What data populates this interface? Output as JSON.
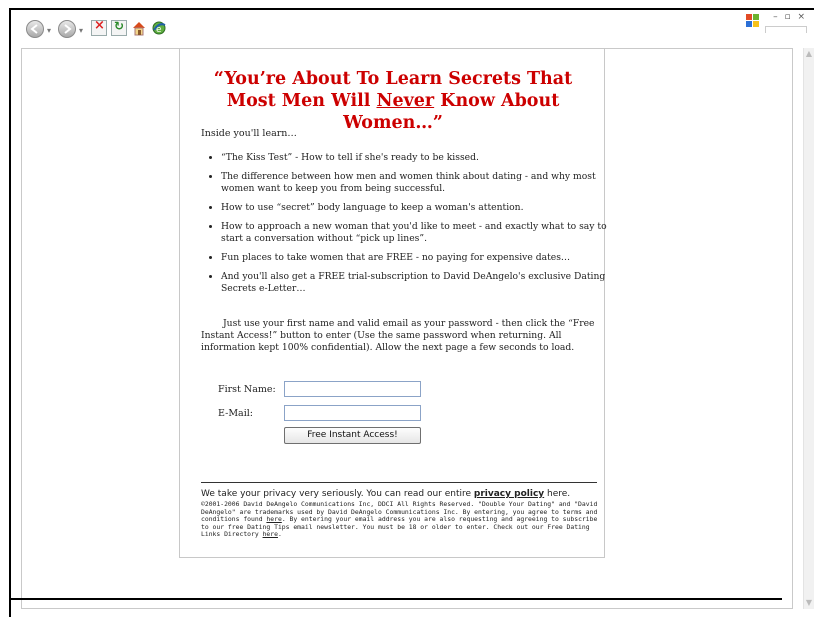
{
  "browser": {
    "window_controls": "– ▫ ×"
  },
  "page": {
    "headline_part1": "“You’re About To Learn Secrets That Most Men Will ",
    "headline_emphasis": "Never",
    "headline_part2": " Know About Women…”",
    "intro": "Inside you'll learn…",
    "bullets": [
      "“The Kiss Test” - How to tell if she's ready to be kissed.",
      "The difference between how men and women think about dating - and why most women want to keep you from being successful.",
      "How to use “secret” body language to keep a woman's attention.",
      "How to approach a new woman that you'd like to meet - and exactly what to say to start a conversation without “pick up lines”.",
      "Fun places to take women that are FREE - no paying for expensive dates…",
      "And you'll also get a FREE trial-subscription to David DeAngelo's exclusive Dating Secrets e-Letter…"
    ],
    "instructions": "Just use your first name and valid email as your password - then click the “Free Instant Access!” button to enter (Use the same password when returning. All information kept 100% confidential). Allow the next page a few seconds to load.",
    "form": {
      "first_name_label": "First Name:",
      "first_name_value": "",
      "email_label": "E-Mail:",
      "email_value": "",
      "submit_label": "Free Instant Access!"
    },
    "privacy": {
      "lead": "We take your privacy very seriously. You can read our entire ",
      "link": "privacy policy",
      "tail": " here.",
      "fine_1": "©2001-2006 David DeAngelo Communications Inc, DDCI All Rights Reserved. \"Double Your Dating\" and \"David DeAngelo\" are trademarks used by David DeAngelo Communications Inc. By entering, you agree to terms and conditions found ",
      "fine_link_1": "here",
      "fine_2": ". By entering your email address you are also requesting and agreeing to subscribe to our free Dating Tips email newsletter. You must be 18 or older to enter. Check out our Free Dating Links Directory ",
      "fine_link_2": "here",
      "fine_3": "."
    }
  }
}
